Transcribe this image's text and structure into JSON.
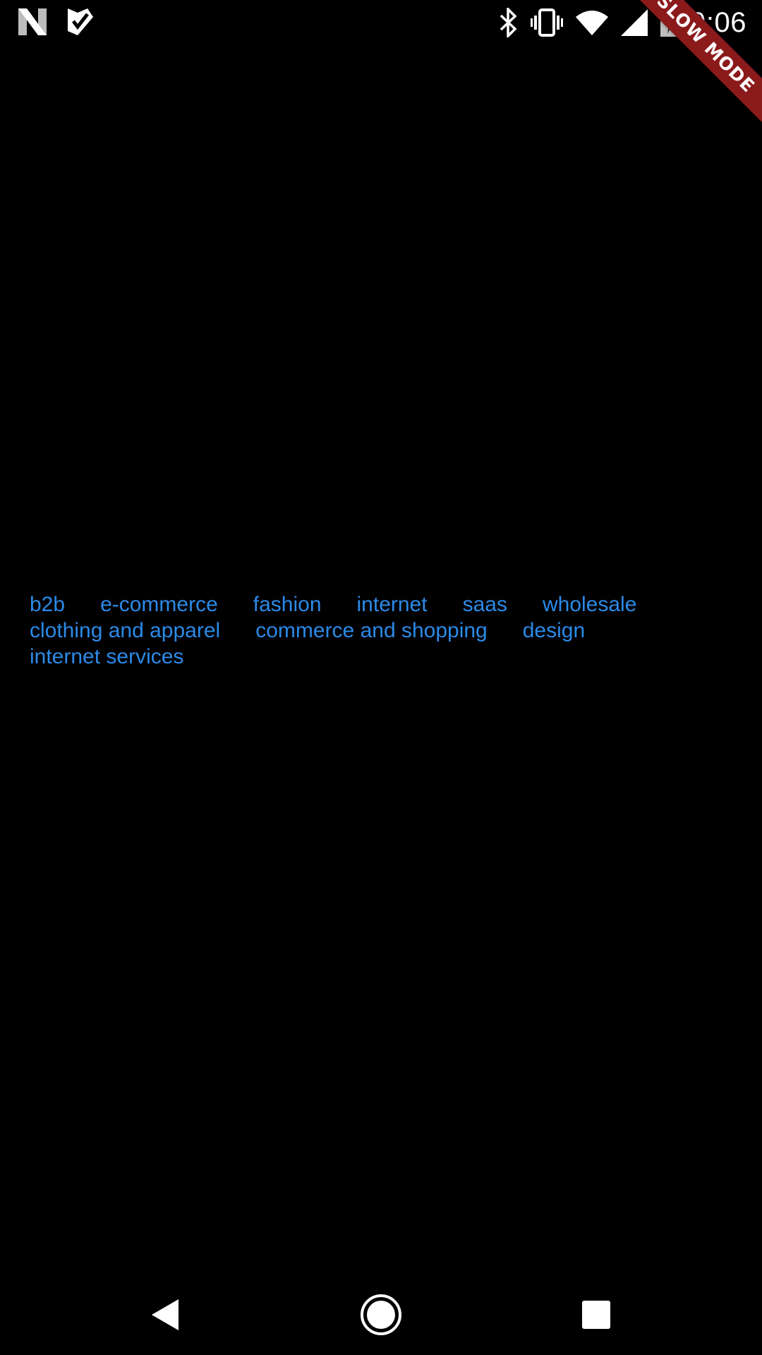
{
  "status_bar": {
    "time": "9:06",
    "left_icons": [
      "n-logo-icon",
      "check-icon"
    ],
    "right_icons": [
      "bluetooth-icon",
      "vibrate-icon",
      "wifi-icon",
      "signal-icon",
      "battery-charging-icon"
    ]
  },
  "ribbon": {
    "label": "SLOW MODE",
    "color": "#8b1a1a"
  },
  "tags": {
    "color": "#2b8ae8",
    "rows": [
      [
        "b2b",
        "e-commerce",
        "fashion",
        "internet",
        "saas",
        "wholesale"
      ],
      [
        "clothing and apparel",
        "commerce and shopping",
        "design"
      ],
      [
        "internet services"
      ]
    ]
  },
  "nav_bar": {
    "icons": [
      "back-icon",
      "home-icon",
      "recents-icon"
    ]
  }
}
